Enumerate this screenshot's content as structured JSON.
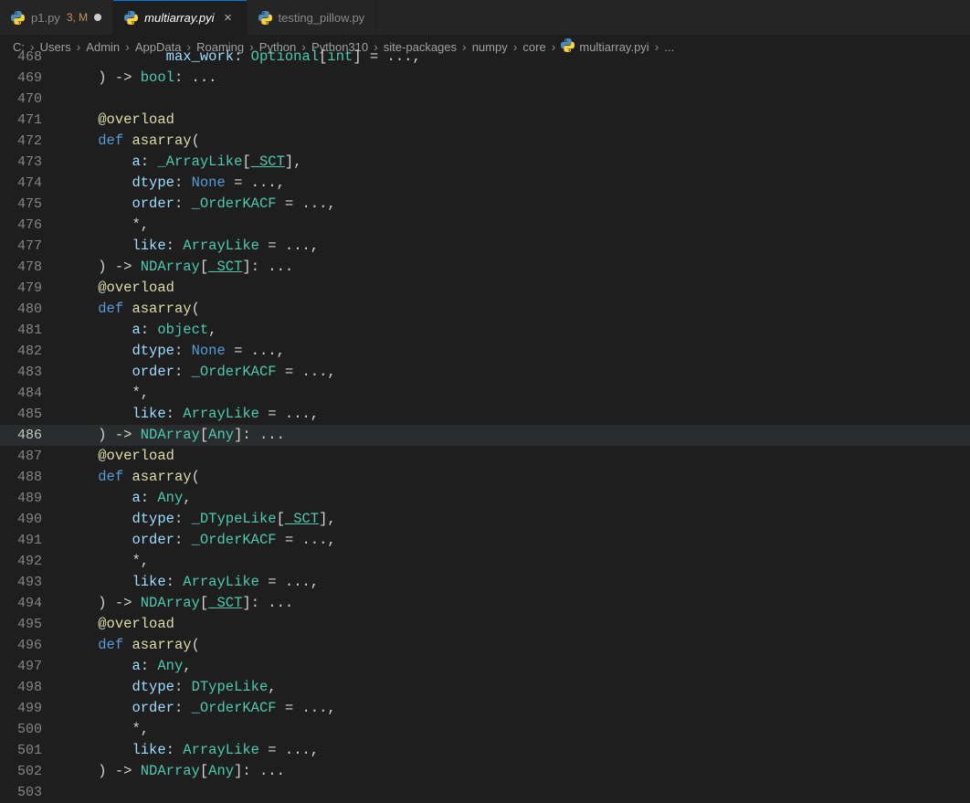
{
  "tabs": [
    {
      "name": "p1.py",
      "git": "3, M",
      "active": false,
      "dirty": true
    },
    {
      "name": "multiarray.pyi",
      "git": "",
      "active": true,
      "dirty": false
    },
    {
      "name": "testing_pillow.py",
      "git": "",
      "active": false,
      "dirty": false
    }
  ],
  "breadcrumb": [
    "C:",
    "Users",
    "Admin",
    "AppData",
    "Roaming",
    "Python",
    "Python310",
    "site-packages",
    "numpy",
    "core",
    "multiarray.pyi",
    "..."
  ],
  "breadcrumb_file_index": 10,
  "lines": [
    {
      "n": 468,
      "truncated": true,
      "t": [
        [
          "",
          "        "
        ],
        [
          "param",
          "max_work"
        ],
        [
          "pun",
          ": "
        ],
        [
          "cls",
          "Optional"
        ],
        [
          "pun",
          "["
        ],
        [
          "cls",
          "int"
        ],
        [
          "pun",
          "] = ..."
        ],
        [
          "pun",
          ","
        ]
      ]
    },
    {
      "n": 469,
      "t": [
        [
          "pun",
          ") "
        ],
        [
          "op",
          "-> "
        ],
        [
          "cls",
          "bool"
        ],
        [
          "pun",
          ": ..."
        ]
      ]
    },
    {
      "n": 470,
      "t": []
    },
    {
      "n": 471,
      "t": [
        [
          "dec",
          "@overload"
        ]
      ]
    },
    {
      "n": 472,
      "t": [
        [
          "kw",
          "def "
        ],
        [
          "fn",
          "asarray"
        ],
        [
          "pun",
          "("
        ]
      ]
    },
    {
      "n": 473,
      "t": [
        [
          "",
          "    "
        ],
        [
          "param",
          "a"
        ],
        [
          "pun",
          ": "
        ],
        [
          "cls",
          "_ArrayLike"
        ],
        [
          "pun",
          "["
        ],
        [
          "cls-u",
          "_SCT"
        ],
        [
          "pun",
          "],"
        ]
      ]
    },
    {
      "n": 474,
      "t": [
        [
          "",
          "    "
        ],
        [
          "param",
          "dtype"
        ],
        [
          "pun",
          ": "
        ],
        [
          "const",
          "None"
        ],
        [
          "pun",
          " = ...,"
        ]
      ]
    },
    {
      "n": 475,
      "t": [
        [
          "",
          "    "
        ],
        [
          "param",
          "order"
        ],
        [
          "pun",
          ": "
        ],
        [
          "cls",
          "_OrderKACF"
        ],
        [
          "pun",
          " = ...,"
        ]
      ]
    },
    {
      "n": 476,
      "t": [
        [
          "",
          "    "
        ],
        [
          "op",
          "*"
        ],
        [
          "pun",
          ","
        ]
      ]
    },
    {
      "n": 477,
      "t": [
        [
          "",
          "    "
        ],
        [
          "param",
          "like"
        ],
        [
          "pun",
          ": "
        ],
        [
          "cls",
          "ArrayLike"
        ],
        [
          "pun",
          " = ...,"
        ]
      ]
    },
    {
      "n": 478,
      "t": [
        [
          "pun",
          ") "
        ],
        [
          "op",
          "-> "
        ],
        [
          "cls",
          "NDArray"
        ],
        [
          "pun",
          "["
        ],
        [
          "cls-u",
          "_SCT"
        ],
        [
          "pun",
          "]: ..."
        ]
      ]
    },
    {
      "n": 479,
      "t": [
        [
          "dec",
          "@overload"
        ]
      ]
    },
    {
      "n": 480,
      "t": [
        [
          "kw",
          "def "
        ],
        [
          "fn",
          "asarray"
        ],
        [
          "pun",
          "("
        ]
      ]
    },
    {
      "n": 481,
      "t": [
        [
          "",
          "    "
        ],
        [
          "param",
          "a"
        ],
        [
          "pun",
          ": "
        ],
        [
          "cls",
          "object"
        ],
        [
          "pun",
          ","
        ]
      ]
    },
    {
      "n": 482,
      "t": [
        [
          "",
          "    "
        ],
        [
          "param",
          "dtype"
        ],
        [
          "pun",
          ": "
        ],
        [
          "const",
          "None"
        ],
        [
          "pun",
          " = ...,"
        ]
      ]
    },
    {
      "n": 483,
      "t": [
        [
          "",
          "    "
        ],
        [
          "param",
          "order"
        ],
        [
          "pun",
          ": "
        ],
        [
          "cls",
          "_OrderKACF"
        ],
        [
          "pun",
          " = ...,"
        ]
      ]
    },
    {
      "n": 484,
      "t": [
        [
          "",
          "    "
        ],
        [
          "op",
          "*"
        ],
        [
          "pun",
          ","
        ]
      ]
    },
    {
      "n": 485,
      "t": [
        [
          "",
          "    "
        ],
        [
          "param",
          "like"
        ],
        [
          "pun",
          ": "
        ],
        [
          "cls",
          "ArrayLike"
        ],
        [
          "pun",
          " = ...,"
        ]
      ]
    },
    {
      "n": 486,
      "hl": true,
      "t": [
        [
          "pun",
          ") "
        ],
        [
          "op",
          "-> "
        ],
        [
          "cls",
          "NDArray"
        ],
        [
          "pun",
          "["
        ],
        [
          "cls",
          "Any"
        ],
        [
          "pun",
          "]: ..."
        ]
      ]
    },
    {
      "n": 487,
      "t": [
        [
          "dec",
          "@overload"
        ]
      ]
    },
    {
      "n": 488,
      "t": [
        [
          "kw",
          "def "
        ],
        [
          "fn",
          "asarray"
        ],
        [
          "pun",
          "("
        ]
      ]
    },
    {
      "n": 489,
      "t": [
        [
          "",
          "    "
        ],
        [
          "param",
          "a"
        ],
        [
          "pun",
          ": "
        ],
        [
          "cls",
          "Any"
        ],
        [
          "pun",
          ","
        ]
      ]
    },
    {
      "n": 490,
      "t": [
        [
          "",
          "    "
        ],
        [
          "param",
          "dtype"
        ],
        [
          "pun",
          ": "
        ],
        [
          "cls",
          "_DTypeLike"
        ],
        [
          "pun",
          "["
        ],
        [
          "cls-u",
          "_SCT"
        ],
        [
          "pun",
          "],"
        ]
      ]
    },
    {
      "n": 491,
      "t": [
        [
          "",
          "    "
        ],
        [
          "param",
          "order"
        ],
        [
          "pun",
          ": "
        ],
        [
          "cls",
          "_OrderKACF"
        ],
        [
          "pun",
          " = ...,"
        ]
      ]
    },
    {
      "n": 492,
      "t": [
        [
          "",
          "    "
        ],
        [
          "op",
          "*"
        ],
        [
          "pun",
          ","
        ]
      ]
    },
    {
      "n": 493,
      "t": [
        [
          "",
          "    "
        ],
        [
          "param",
          "like"
        ],
        [
          "pun",
          ": "
        ],
        [
          "cls",
          "ArrayLike"
        ],
        [
          "pun",
          " = ...,"
        ]
      ]
    },
    {
      "n": 494,
      "t": [
        [
          "pun",
          ") "
        ],
        [
          "op",
          "-> "
        ],
        [
          "cls",
          "NDArray"
        ],
        [
          "pun",
          "["
        ],
        [
          "cls-u",
          "_SCT"
        ],
        [
          "pun",
          "]: ..."
        ]
      ]
    },
    {
      "n": 495,
      "t": [
        [
          "dec",
          "@overload"
        ]
      ]
    },
    {
      "n": 496,
      "t": [
        [
          "kw",
          "def "
        ],
        [
          "fn",
          "asarray"
        ],
        [
          "pun",
          "("
        ]
      ]
    },
    {
      "n": 497,
      "t": [
        [
          "",
          "    "
        ],
        [
          "param",
          "a"
        ],
        [
          "pun",
          ": "
        ],
        [
          "cls",
          "Any"
        ],
        [
          "pun",
          ","
        ]
      ]
    },
    {
      "n": 498,
      "t": [
        [
          "",
          "    "
        ],
        [
          "param",
          "dtype"
        ],
        [
          "pun",
          ": "
        ],
        [
          "cls",
          "DTypeLike"
        ],
        [
          "pun",
          ","
        ]
      ]
    },
    {
      "n": 499,
      "t": [
        [
          "",
          "    "
        ],
        [
          "param",
          "order"
        ],
        [
          "pun",
          ": "
        ],
        [
          "cls",
          "_OrderKACF"
        ],
        [
          "pun",
          " = ...,"
        ]
      ]
    },
    {
      "n": 500,
      "t": [
        [
          "",
          "    "
        ],
        [
          "op",
          "*"
        ],
        [
          "pun",
          ","
        ]
      ]
    },
    {
      "n": 501,
      "t": [
        [
          "",
          "    "
        ],
        [
          "param",
          "like"
        ],
        [
          "pun",
          ": "
        ],
        [
          "cls",
          "ArrayLike"
        ],
        [
          "pun",
          " = ...,"
        ]
      ]
    },
    {
      "n": 502,
      "t": [
        [
          "pun",
          ") "
        ],
        [
          "op",
          "-> "
        ],
        [
          "cls",
          "NDArray"
        ],
        [
          "pun",
          "["
        ],
        [
          "cls",
          "Any"
        ],
        [
          "pun",
          "]: ..."
        ]
      ]
    },
    {
      "n": 503,
      "t": []
    }
  ],
  "indent": "    "
}
